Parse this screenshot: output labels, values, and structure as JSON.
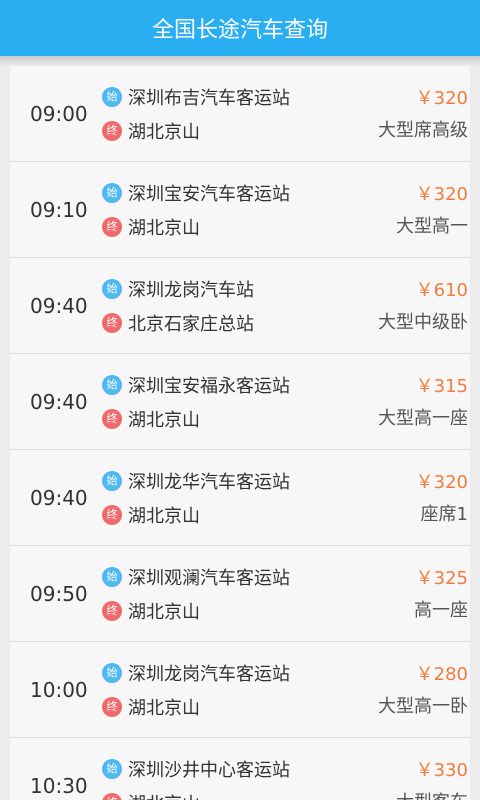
{
  "header": {
    "title": "全国长途汽车查询"
  },
  "badges": {
    "start": "始",
    "end": "终"
  },
  "trips": [
    {
      "time": "09:00",
      "from": "深圳布吉汽车客运站",
      "to": "湖北京山",
      "price": "￥320",
      "type": "大型席高级"
    },
    {
      "time": "09:10",
      "from": "深圳宝安汽车客运站",
      "to": "湖北京山",
      "price": "￥320",
      "type": "大型高一"
    },
    {
      "time": "09:40",
      "from": "深圳龙岗汽车站",
      "to": "北京石家庄总站",
      "price": "￥610",
      "type": "大型中级卧"
    },
    {
      "time": "09:40",
      "from": "深圳宝安福永客运站",
      "to": "湖北京山",
      "price": "￥315",
      "type": "大型高一座"
    },
    {
      "time": "09:40",
      "from": "深圳龙华汽车客运站",
      "to": "湖北京山",
      "price": "￥320",
      "type": "座席1"
    },
    {
      "time": "09:50",
      "from": "深圳观澜汽车客运站",
      "to": "湖北京山",
      "price": "￥325",
      "type": "高一座"
    },
    {
      "time": "10:00",
      "from": "深圳龙岗汽车客运站",
      "to": "湖北京山",
      "price": "￥280",
      "type": "大型高一卧"
    },
    {
      "time": "10:30",
      "from": "深圳沙井中心客运站",
      "to": "湖北京山",
      "price": "￥330",
      "type": "大型客车"
    }
  ]
}
